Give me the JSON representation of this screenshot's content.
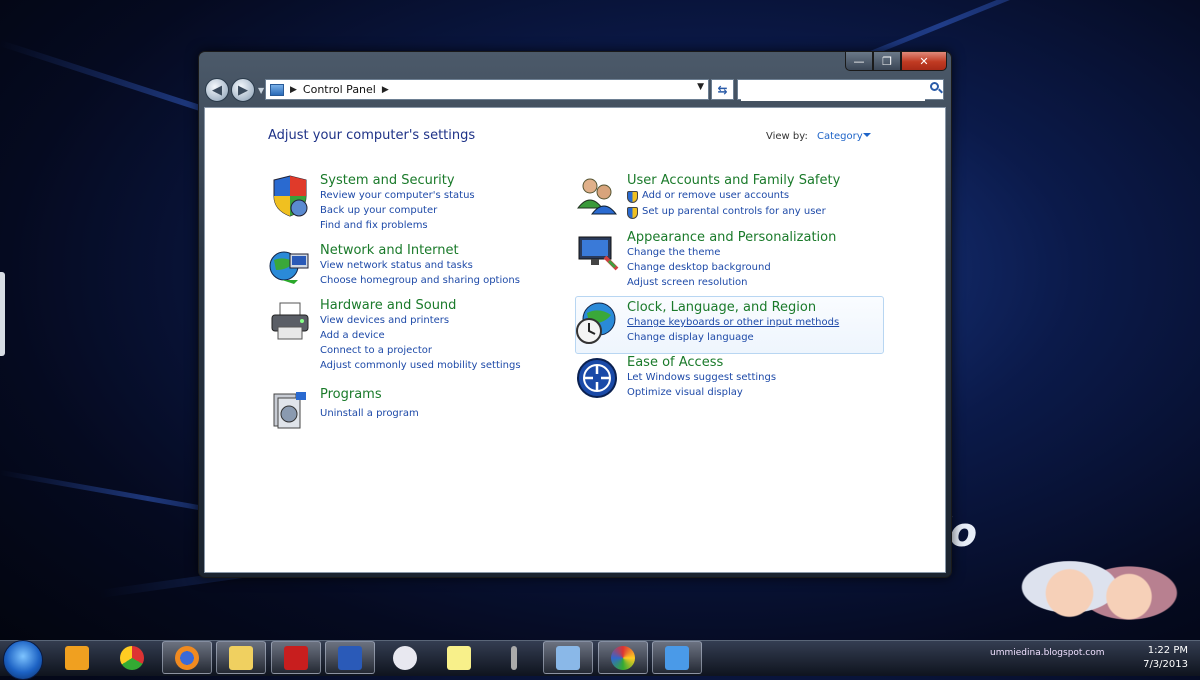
{
  "window": {
    "caption": {
      "minimize": "—",
      "maximize": "❐",
      "close": "✕"
    },
    "address": {
      "crumb": "Control Panel"
    },
    "search": {
      "placeholder": ""
    },
    "page_title": "Adjust your computer's settings",
    "view_by": {
      "label": "View by:",
      "value": "Category"
    }
  },
  "categories": {
    "system": {
      "title": "System and Security",
      "links": [
        "Review your computer's status",
        "Back up your computer",
        "Find and fix problems"
      ]
    },
    "network": {
      "title": "Network and Internet",
      "links": [
        "View network status and tasks",
        "Choose homegroup and sharing options"
      ]
    },
    "hardware": {
      "title": "Hardware and Sound",
      "links": [
        "View devices and printers",
        "Add a device",
        "Connect to a projector",
        "Adjust commonly used mobility settings"
      ]
    },
    "programs": {
      "title": "Programs",
      "links": [
        "Uninstall a program"
      ]
    },
    "users": {
      "title": "User Accounts and Family Safety",
      "links": [
        "Add or remove user accounts",
        "Set up parental controls for any user"
      ]
    },
    "appearance": {
      "title": "Appearance and Personalization",
      "links": [
        "Change the theme",
        "Change desktop background",
        "Adjust screen resolution"
      ]
    },
    "clock": {
      "title": "Clock, Language, and Region",
      "links": [
        "Change keyboards or other input methods",
        "Change display language"
      ]
    },
    "ease": {
      "title": "Ease of Access",
      "links": [
        "Let Windows suggest settings",
        "Optimize visual display"
      ]
    }
  },
  "taskbar": {
    "items": [
      "start-button",
      "media-player",
      "chrome",
      "firefox",
      "windows-explorer",
      "adobe-reader",
      "microsoft-word",
      "paint",
      "sticky-notes",
      "microphone",
      "remote-desktop",
      "pinwheel-app",
      "control-panel"
    ],
    "clock": {
      "time": "1:22 PM",
      "date": "7/3/2013"
    },
    "watermark": "ummiedina.blogspot.com"
  },
  "colors": {
    "category_title": "#1a7a2a",
    "link": "#1e4aa8",
    "page_title": "#1e3287"
  }
}
